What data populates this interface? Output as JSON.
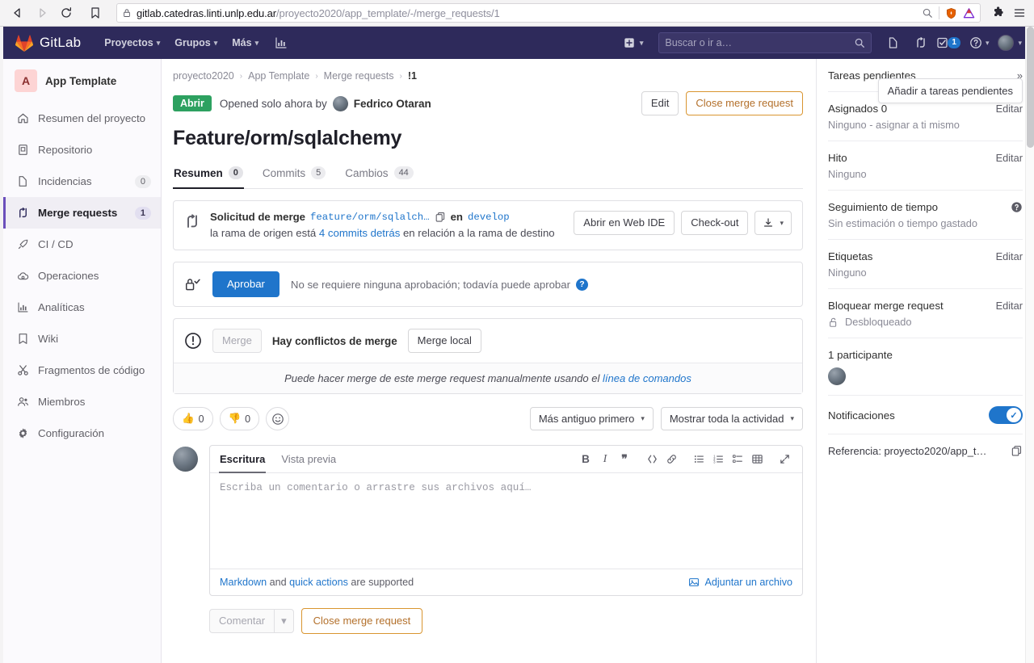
{
  "browser": {
    "back_icon": "back-arrow-icon",
    "forward_icon": "forward-arrow-icon",
    "reload_icon": "reload-icon",
    "bookmark_icon": "bookmark-icon",
    "lock_icon": "lock-icon",
    "url_host": "gitlab.catedras.linti.unlp.edu.ar",
    "url_path": "/proyecto2020/app_template/-/merge_requests/1",
    "zoom_icon": "search-minus-icon",
    "shield_icon": "shield-icon",
    "warning_icon": "triangle-warning-icon",
    "extensions_icon": "puzzle-icon",
    "menu_icon": "hamburger-menu-icon"
  },
  "topnav": {
    "brand": "GitLab",
    "logo_icon": "gitlab-fox-icon",
    "links": [
      {
        "label": "Proyectos",
        "caret": true
      },
      {
        "label": "Grupos",
        "caret": true
      },
      {
        "label": "Más",
        "caret": true
      }
    ],
    "analytics_icon": "bar-chart-icon",
    "plus_icon": "plus-square-icon",
    "search_placeholder": "Buscar o ir a…",
    "search_icon": "search-icon",
    "issues_icon": "issues-icon",
    "merge_requests_icon": "merge-request-icon",
    "todos_icon": "todo-list-icon",
    "todos_count": "1",
    "help_icon": "help-circle-icon",
    "avatar_icon": "user-avatar"
  },
  "sidebar": {
    "project_initial": "A",
    "project_name": "App Template",
    "items": [
      {
        "label": "Resumen del proyecto",
        "icon": "home-icon",
        "count": "",
        "active": false
      },
      {
        "label": "Repositorio",
        "icon": "repository-icon",
        "count": "",
        "active": false
      },
      {
        "label": "Incidencias",
        "icon": "issues-icon",
        "count": "0",
        "active": false
      },
      {
        "label": "Merge requests",
        "icon": "merge-request-icon",
        "count": "1",
        "active": true
      },
      {
        "label": "CI / CD",
        "icon": "rocket-icon",
        "count": "",
        "active": false
      },
      {
        "label": "Operaciones",
        "icon": "cloud-gear-icon",
        "count": "",
        "active": false
      },
      {
        "label": "Analíticas",
        "icon": "bar-chart-icon",
        "count": "",
        "active": false
      },
      {
        "label": "Wiki",
        "icon": "book-icon",
        "count": "",
        "active": false
      },
      {
        "label": "Fragmentos de código",
        "icon": "scissors-icon",
        "count": "",
        "active": false
      },
      {
        "label": "Miembros",
        "icon": "users-icon",
        "count": "",
        "active": false
      },
      {
        "label": "Configuración",
        "icon": "gear-icon",
        "count": "",
        "active": false
      }
    ]
  },
  "breadcrumb": {
    "items": [
      "proyecto2020",
      "App Template",
      "Merge requests"
    ],
    "current": "!1",
    "separator": "›"
  },
  "merge_request": {
    "status_badge": "Abrir",
    "opened_text": "Opened solo ahora by",
    "author": "Fedrico Otaran",
    "edit_button": "Edit",
    "close_button": "Close merge request",
    "title": "Feature/orm/sqlalchemy",
    "tabs": [
      {
        "label": "Resumen",
        "count": "0",
        "active": true
      },
      {
        "label": "Commits",
        "count": "5",
        "active": false
      },
      {
        "label": "Cambios",
        "count": "44",
        "active": false
      }
    ]
  },
  "source_widget": {
    "icon": "merge-request-icon",
    "prefix": "Solicitud de merge",
    "source_branch": "feature/orm/sqlalch…",
    "copy_icon": "copy-clipboard-icon",
    "into_label": "en",
    "target_branch": "develop",
    "line2_prefix": "la rama de origen está",
    "line2_link": "4 commits detrás",
    "line2_suffix": "en relación a la rama de destino",
    "web_ide_button": "Abrir en Web IDE",
    "checkout_button": "Check-out",
    "download_icon": "download-icon",
    "download_caret": "▾"
  },
  "approve_widget": {
    "icon": "approval-lock-check-icon",
    "approve_button": "Aprobar",
    "text": "No se requiere ninguna aprobación; todavía puede aprobar",
    "help_badge": "?"
  },
  "merge_widget": {
    "icon": "exclamation-circle-icon",
    "merge_button": "Merge",
    "conflict_label": "Hay conflictos de merge",
    "merge_local_button": "Merge local",
    "footer_text": "Puede hacer merge de este merge request manualmente usando el",
    "footer_link": "línea de comandos"
  },
  "reactions": {
    "thumbs_up_icon": "thumbs-up-icon",
    "thumbs_up_count": "0",
    "thumbs_down_icon": "thumbs-down-icon",
    "thumbs_down_count": "0",
    "add_reaction_icon": "smiley-face-icon",
    "sort_dropdown": "Más antiguo primero",
    "filter_dropdown": "Mostrar toda la actividad",
    "caret": "▾"
  },
  "comment_form": {
    "tab_write": "Escritura",
    "tab_preview": "Vista previa",
    "toolbar": [
      {
        "icon": "bold-icon",
        "glyph": "B"
      },
      {
        "icon": "italic-icon",
        "glyph": "I"
      },
      {
        "icon": "quote-icon",
        "glyph": "❞"
      },
      {
        "icon": "code-icon",
        "glyph": "</>"
      },
      {
        "icon": "link-icon",
        "glyph": "🔗"
      },
      {
        "icon": "bulleted-list-icon",
        "glyph": "≔"
      },
      {
        "icon": "numbered-list-icon",
        "glyph": "≕"
      },
      {
        "icon": "task-list-icon",
        "glyph": "☑"
      },
      {
        "icon": "table-icon",
        "glyph": "▦"
      },
      {
        "icon": "fullscreen-icon",
        "glyph": "⤢"
      }
    ],
    "placeholder": "Escriba un comentario o arrastre sus archivos aquí…",
    "value": "",
    "footer_markdown": "Markdown",
    "footer_and": "and",
    "footer_quick_actions": "quick actions",
    "footer_supported": "are supported",
    "attach_icon": "image-attach-icon",
    "attach_label": "Adjuntar un archivo",
    "comment_button": "Comentar",
    "comment_caret": "▾",
    "close_button": "Close merge request"
  },
  "right_sidebar": {
    "todo": {
      "title": "Tareas pendientes",
      "collapse_icon": "»",
      "tooltip": "Añadir a tareas pendientes"
    },
    "assignees": {
      "title": "Asignados 0",
      "edit": "Editar",
      "value": "Ninguno - asignar a ti mismo"
    },
    "milestone": {
      "title": "Hito",
      "edit": "Editar",
      "value": "Ninguno"
    },
    "time_tracking": {
      "title": "Seguimiento de tiempo",
      "help_icon": "help-circle-icon",
      "value": "Sin estimación o tiempo gastado"
    },
    "labels": {
      "title": "Etiquetas",
      "edit": "Editar",
      "value": "Ninguno"
    },
    "lock": {
      "title": "Bloquear merge request",
      "edit": "Editar",
      "lock_icon": "unlock-icon",
      "value": "Desbloqueado"
    },
    "participants": {
      "title": "1 participante",
      "avatar_icon": "user-avatar"
    },
    "notifications": {
      "title": "Notificaciones",
      "toggle_on": true,
      "toggle_icon": "check-icon"
    },
    "reference": {
      "title": "Referencia: proyecto2020/app_t…",
      "copy_icon": "copy-clipboard-icon"
    }
  },
  "colors": {
    "gitlab_navy": "#2e2a5b",
    "accent_purple": "#6b4fbb",
    "link_blue": "#1f75cb",
    "status_green": "#2da160",
    "warning_orange": "#d99530"
  }
}
